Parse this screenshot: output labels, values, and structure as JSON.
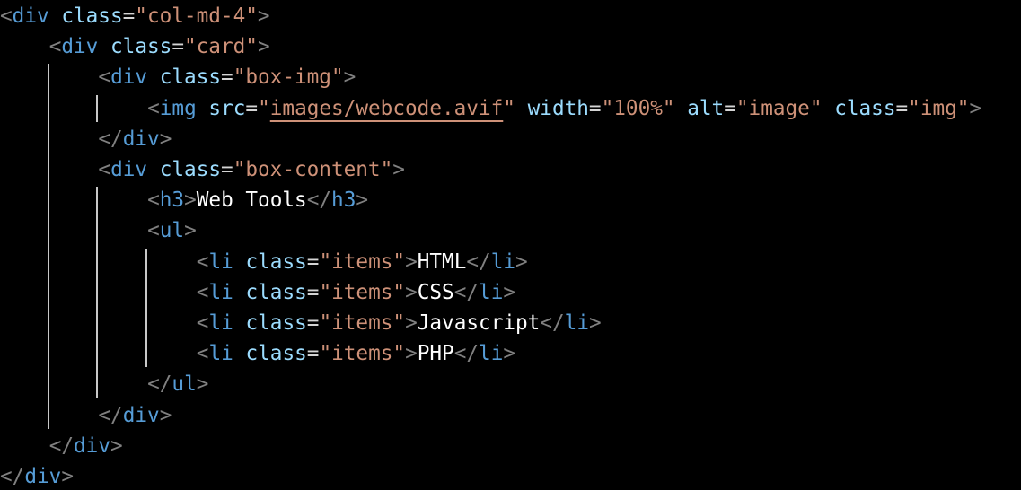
{
  "code": {
    "lines": [
      {
        "indent": 0,
        "tokens": [
          {
            "t": "<",
            "c": "bracket"
          },
          {
            "t": "div",
            "c": "tag"
          },
          {
            "t": " "
          },
          {
            "t": "class",
            "c": "attr"
          },
          {
            "t": "=",
            "c": "eq"
          },
          {
            "t": "\"col-md-4\"",
            "c": "str"
          },
          {
            "t": ">",
            "c": "bracket"
          }
        ]
      },
      {
        "indent": 1,
        "tokens": [
          {
            "t": "<",
            "c": "bracket"
          },
          {
            "t": "div",
            "c": "tag"
          },
          {
            "t": " "
          },
          {
            "t": "class",
            "c": "attr"
          },
          {
            "t": "=",
            "c": "eq"
          },
          {
            "t": "\"card\"",
            "c": "str"
          },
          {
            "t": ">",
            "c": "bracket"
          }
        ]
      },
      {
        "indent": 2,
        "tokens": [
          {
            "t": "<",
            "c": "bracket"
          },
          {
            "t": "div",
            "c": "tag"
          },
          {
            "t": " "
          },
          {
            "t": "class",
            "c": "attr"
          },
          {
            "t": "=",
            "c": "eq"
          },
          {
            "t": "\"box-img\"",
            "c": "str"
          },
          {
            "t": ">",
            "c": "bracket"
          }
        ]
      },
      {
        "indent": 3,
        "tokens": [
          {
            "t": "<",
            "c": "bracket"
          },
          {
            "t": "img",
            "c": "tag"
          },
          {
            "t": " "
          },
          {
            "t": "src",
            "c": "attr"
          },
          {
            "t": "=",
            "c": "eq"
          },
          {
            "t": "\"",
            "c": "str"
          },
          {
            "t": "images/webcode.avif",
            "c": "link"
          },
          {
            "t": "\"",
            "c": "str"
          },
          {
            "t": " "
          },
          {
            "t": "width",
            "c": "attr"
          },
          {
            "t": "=",
            "c": "eq"
          },
          {
            "t": "\"100%\"",
            "c": "str"
          },
          {
            "t": " "
          },
          {
            "t": "alt",
            "c": "attr"
          },
          {
            "t": "=",
            "c": "eq"
          },
          {
            "t": "\"image\"",
            "c": "str"
          },
          {
            "t": " "
          },
          {
            "t": "class",
            "c": "attr"
          },
          {
            "t": "=",
            "c": "eq"
          },
          {
            "t": "\"img\"",
            "c": "str"
          },
          {
            "t": ">",
            "c": "bracket"
          }
        ]
      },
      {
        "indent": 2,
        "tokens": [
          {
            "t": "</",
            "c": "bracket"
          },
          {
            "t": "div",
            "c": "tag"
          },
          {
            "t": ">",
            "c": "bracket"
          }
        ]
      },
      {
        "indent": 2,
        "tokens": [
          {
            "t": "<",
            "c": "bracket"
          },
          {
            "t": "div",
            "c": "tag"
          },
          {
            "t": " "
          },
          {
            "t": "class",
            "c": "attr"
          },
          {
            "t": "=",
            "c": "eq"
          },
          {
            "t": "\"box-content\"",
            "c": "str"
          },
          {
            "t": ">",
            "c": "bracket"
          }
        ]
      },
      {
        "indent": 3,
        "tokens": [
          {
            "t": "<",
            "c": "bracket"
          },
          {
            "t": "h3",
            "c": "tag"
          },
          {
            "t": ">",
            "c": "bracket"
          },
          {
            "t": "Web Tools",
            "c": "text"
          },
          {
            "t": "</",
            "c": "bracket"
          },
          {
            "t": "h3",
            "c": "tag"
          },
          {
            "t": ">",
            "c": "bracket"
          }
        ]
      },
      {
        "indent": 3,
        "tokens": [
          {
            "t": "<",
            "c": "bracket"
          },
          {
            "t": "ul",
            "c": "tag"
          },
          {
            "t": ">",
            "c": "bracket"
          }
        ]
      },
      {
        "indent": 4,
        "tokens": [
          {
            "t": "<",
            "c": "bracket"
          },
          {
            "t": "li",
            "c": "tag"
          },
          {
            "t": " "
          },
          {
            "t": "class",
            "c": "attr"
          },
          {
            "t": "=",
            "c": "eq"
          },
          {
            "t": "\"items\"",
            "c": "str"
          },
          {
            "t": ">",
            "c": "bracket"
          },
          {
            "t": "HTML",
            "c": "text"
          },
          {
            "t": "</",
            "c": "bracket"
          },
          {
            "t": "li",
            "c": "tag"
          },
          {
            "t": ">",
            "c": "bracket"
          }
        ]
      },
      {
        "indent": 4,
        "tokens": [
          {
            "t": "<",
            "c": "bracket"
          },
          {
            "t": "li",
            "c": "tag"
          },
          {
            "t": " "
          },
          {
            "t": "class",
            "c": "attr"
          },
          {
            "t": "=",
            "c": "eq"
          },
          {
            "t": "\"items\"",
            "c": "str"
          },
          {
            "t": ">",
            "c": "bracket"
          },
          {
            "t": "CSS",
            "c": "text"
          },
          {
            "t": "</",
            "c": "bracket"
          },
          {
            "t": "li",
            "c": "tag"
          },
          {
            "t": ">",
            "c": "bracket"
          }
        ]
      },
      {
        "indent": 4,
        "tokens": [
          {
            "t": "<",
            "c": "bracket"
          },
          {
            "t": "li",
            "c": "tag"
          },
          {
            "t": " "
          },
          {
            "t": "class",
            "c": "attr"
          },
          {
            "t": "=",
            "c": "eq"
          },
          {
            "t": "\"items\"",
            "c": "str"
          },
          {
            "t": ">",
            "c": "bracket"
          },
          {
            "t": "Javascript",
            "c": "text"
          },
          {
            "t": "</",
            "c": "bracket"
          },
          {
            "t": "li",
            "c": "tag"
          },
          {
            "t": ">",
            "c": "bracket"
          }
        ]
      },
      {
        "indent": 4,
        "tokens": [
          {
            "t": "<",
            "c": "bracket"
          },
          {
            "t": "li",
            "c": "tag"
          },
          {
            "t": " "
          },
          {
            "t": "class",
            "c": "attr"
          },
          {
            "t": "=",
            "c": "eq"
          },
          {
            "t": "\"items\"",
            "c": "str"
          },
          {
            "t": ">",
            "c": "bracket"
          },
          {
            "t": "PHP",
            "c": "text"
          },
          {
            "t": "</",
            "c": "bracket"
          },
          {
            "t": "li",
            "c": "tag"
          },
          {
            "t": ">",
            "c": "bracket"
          }
        ]
      },
      {
        "indent": 3,
        "tokens": [
          {
            "t": "</",
            "c": "bracket"
          },
          {
            "t": "ul",
            "c": "tag"
          },
          {
            "t": ">",
            "c": "bracket"
          }
        ]
      },
      {
        "indent": 2,
        "tokens": [
          {
            "t": "</",
            "c": "bracket"
          },
          {
            "t": "div",
            "c": "tag"
          },
          {
            "t": ">",
            "c": "bracket"
          }
        ]
      },
      {
        "indent": 1,
        "tokens": [
          {
            "t": "</",
            "c": "bracket"
          },
          {
            "t": "div",
            "c": "tag"
          },
          {
            "t": ">",
            "c": "bracket"
          }
        ]
      },
      {
        "indent": 0,
        "tokens": [
          {
            "t": "</",
            "c": "bracket"
          },
          {
            "t": "div",
            "c": "tag"
          },
          {
            "t": ">",
            "c": "bracket"
          }
        ]
      }
    ]
  },
  "colors": {
    "background": "#000000",
    "bracket": "#808080",
    "tag": "#569cd6",
    "attribute": "#9cdcfe",
    "string": "#ce9178",
    "text": "#ffffff",
    "indent_guide": "#c8c8c8"
  }
}
